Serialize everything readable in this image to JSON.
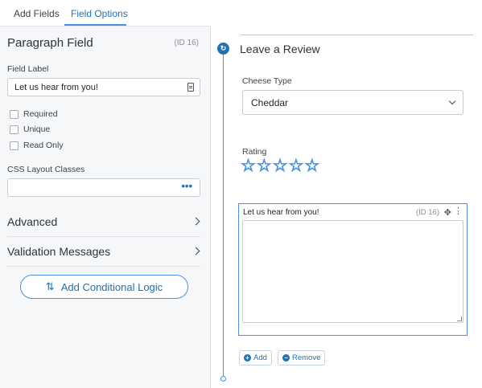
{
  "tabs": [
    {
      "label": "Add Fields"
    },
    {
      "label": "Field Options"
    }
  ],
  "field": {
    "title": "Paragraph Field",
    "id_label": "(ID 16)",
    "label_caption": "Field Label",
    "label_value": "Let us hear from you!",
    "checkboxes": [
      {
        "label": "Required",
        "checked": false
      },
      {
        "label": "Unique",
        "checked": false
      },
      {
        "label": "Read Only",
        "checked": false
      }
    ],
    "css_caption": "CSS Layout Classes",
    "css_value": "",
    "css_more": "•••"
  },
  "sections": [
    {
      "label": "Advanced"
    },
    {
      "label": "Validation Messages"
    }
  ],
  "conditional_button": {
    "label": "Add Conditional Logic",
    "icon": "⇅"
  },
  "form": {
    "title": "Leave a Review",
    "cheese": {
      "label": "Cheese Type",
      "value": "Cheddar"
    },
    "rating": {
      "label": "Rating",
      "stars": [
        "☆",
        "☆",
        "☆",
        "☆",
        "☆"
      ],
      "value": 0,
      "max": 5
    },
    "paragraph": {
      "label": "Let us hear from you!",
      "id_label": "(ID 16)",
      "move_glyph": "✥",
      "more_glyph": "⋮"
    },
    "add_button": {
      "label": "Add",
      "glyph": "+"
    },
    "remove_button": {
      "label": "Remove",
      "glyph": "−"
    }
  },
  "timeline": {
    "node_glyph": "↻"
  },
  "colors": {
    "accent": "#2271b1",
    "border_accent": "#4a90e2"
  }
}
